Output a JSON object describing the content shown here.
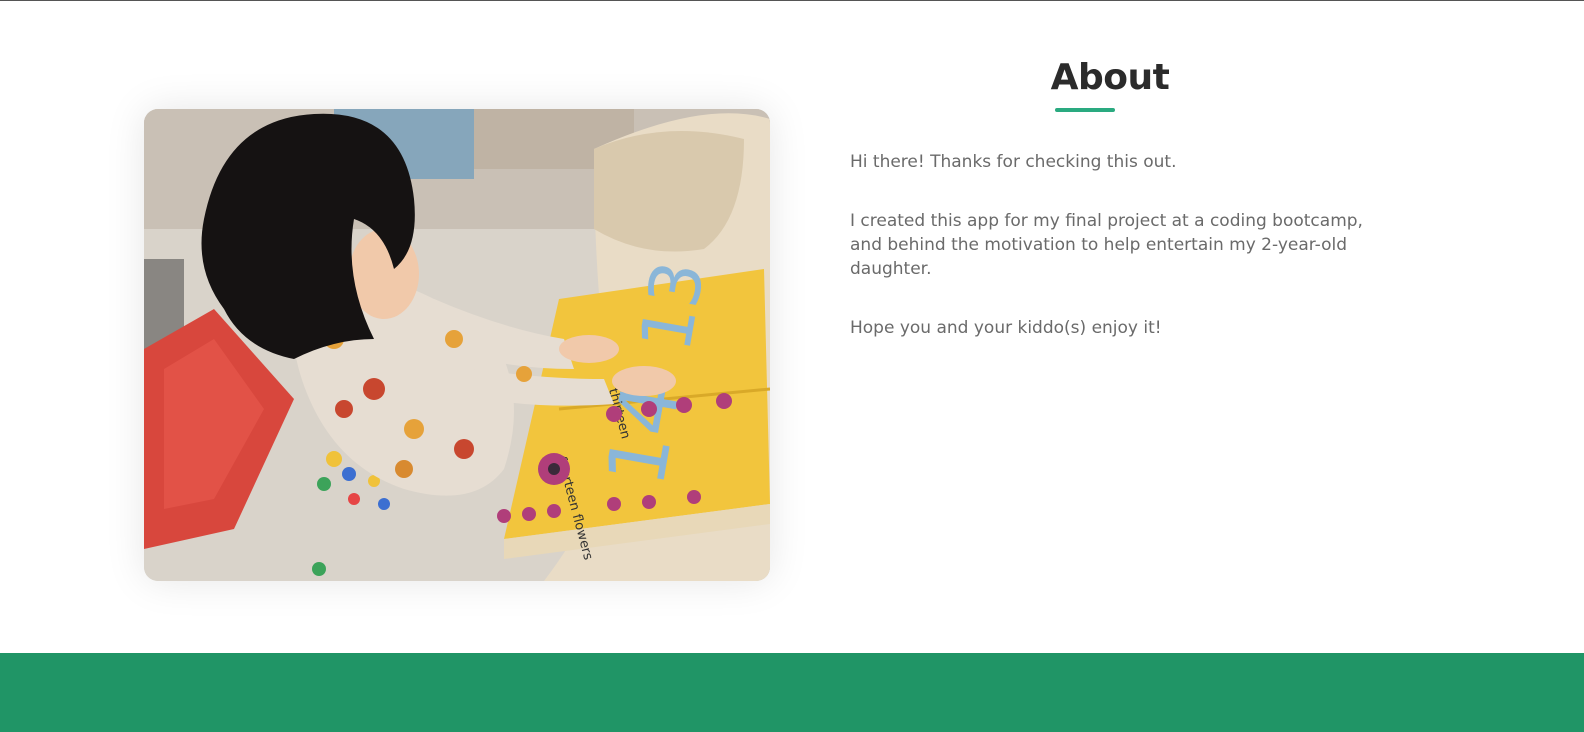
{
  "about": {
    "title": "About",
    "paragraphs": [
      "Hi there! Thanks for checking this out.",
      "I created this app for my final project at a coding bootcamp, and behind the motivation to help entertain my 2-year-old daughter.",
      "Hope you and your kiddo(s) enjoy it!"
    ]
  },
  "photo": {
    "book_page_top_label": "thirteen",
    "book_page_top_number": "13",
    "book_page_bottom_label": "fourteen flowers",
    "book_page_bottom_number": "14"
  },
  "colors": {
    "accent": "#2aaa80",
    "footer": "#209566",
    "heading": "#2b2b2b",
    "body_text": "#6a6a6a"
  }
}
